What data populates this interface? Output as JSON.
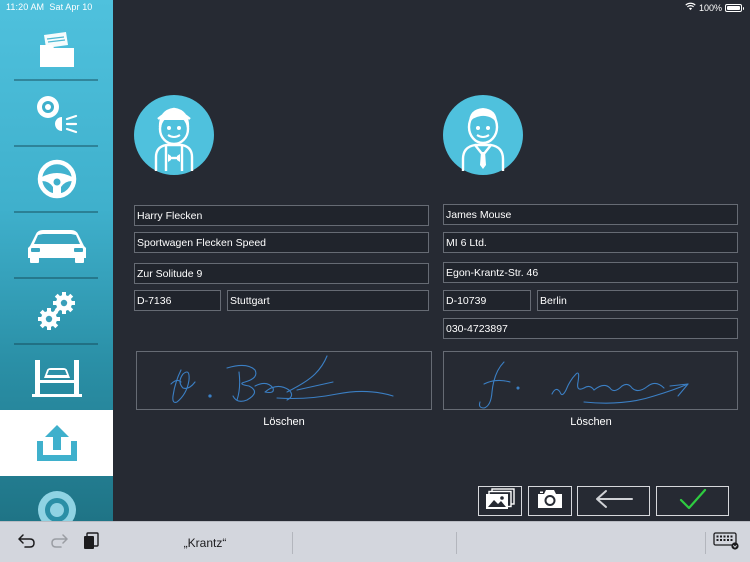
{
  "status_bar": {
    "time": "11:20 AM",
    "date": "Sat Apr 10",
    "battery": "100%",
    "battery_level": 1.0,
    "icons": [
      "wifi-icon",
      "battery-icon"
    ]
  },
  "sidebar": {
    "items": [
      {
        "name": "folder",
        "icon": "folder-icon"
      },
      {
        "name": "brakes-lights",
        "icon": "brake-light-icon"
      },
      {
        "name": "steering",
        "icon": "steering-wheel-icon"
      },
      {
        "name": "car",
        "icon": "car-icon"
      },
      {
        "name": "settings",
        "icon": "gears-icon"
      },
      {
        "name": "lift",
        "icon": "car-lift-icon"
      },
      {
        "name": "upload",
        "icon": "upload-icon",
        "active": true
      },
      {
        "name": "tire",
        "icon": "tire-icon"
      }
    ]
  },
  "left_party": {
    "avatar_icon": "mechanic-avatar-icon",
    "name": "Harry Flecken",
    "company": "Sportwagen Flecken Speed",
    "street": "Zur Solitude 9",
    "zip": "D-7136",
    "city": "Stuttgart",
    "clear_label": "Löschen"
  },
  "right_party": {
    "avatar_icon": "businessman-avatar-icon",
    "name": "James Mouse",
    "company": "MI 6 Ltd.",
    "street": "Egon-Krantz-Str. 46",
    "zip": "D-10739",
    "city": "Berlin",
    "phone": "030-4723897",
    "clear_label": "Löschen"
  },
  "actions": {
    "icons": [
      "gallery-icon",
      "camera-icon",
      "back-arrow-icon",
      "confirm-check-icon"
    ],
    "confirm_color": "#2ecc40"
  },
  "keyboard_bar": {
    "suggestion": "„Krantz“",
    "icons": [
      "undo-icon",
      "redo-icon",
      "paste-icon",
      "keyboard-icon"
    ]
  },
  "colors": {
    "accent": "#4fc1dd",
    "background": "#262a33",
    "signature_ink": "#3b7fc4"
  }
}
